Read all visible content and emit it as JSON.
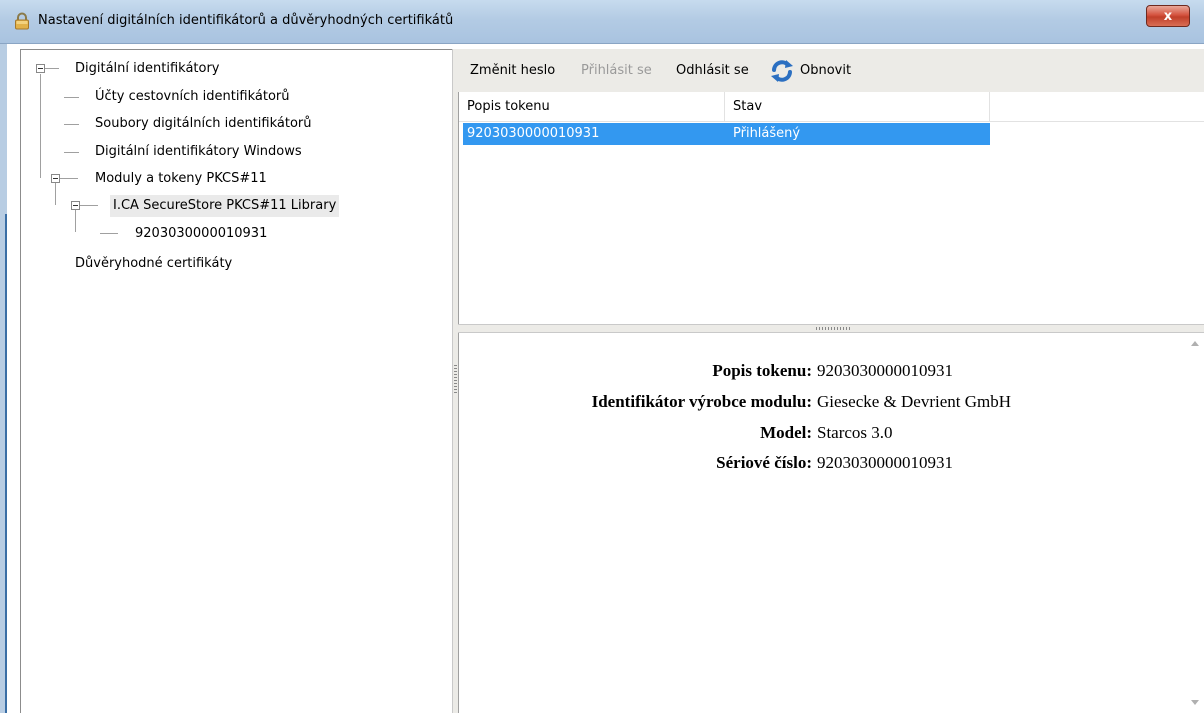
{
  "window": {
    "title": "Nastavení digitálních identifikátorů a důvěryhodných certifikátů",
    "close_label": "x"
  },
  "tree": {
    "root": "Digitální identifikátory",
    "children": [
      "Účty cestovních identifikátorů",
      "Soubory digitálních identifikátorů",
      "Digitální identifikátory Windows"
    ],
    "pkcs_module": "Moduly a tokeny PKCS#11",
    "library": "I.CA SecureStore PKCS#11 Library",
    "token": "9203030000010931",
    "trusted": "Důvěryhodné certifikáty"
  },
  "toolbar": {
    "change_password": "Změnit heslo",
    "login": "Přihlásit se",
    "logout": "Odhlásit se",
    "refresh": "Obnovit",
    "refresh_icon": "refresh-icon"
  },
  "table": {
    "headers": [
      "Popis tokenu",
      "Stav"
    ],
    "rows": [
      {
        "description": "9203030000010931",
        "status": "Přihlášený"
      }
    ],
    "selected_color": "#3398f0"
  },
  "details": [
    {
      "label": "Popis tokenu:",
      "value": "9203030000010931"
    },
    {
      "label": "Identifikátor výrobce modulu:",
      "value": "Giesecke & Devrient GmbH"
    },
    {
      "label": "Model:",
      "value": "Starcos 3.0"
    },
    {
      "label": "Sériové číslo:",
      "value": "9203030000010931"
    }
  ]
}
